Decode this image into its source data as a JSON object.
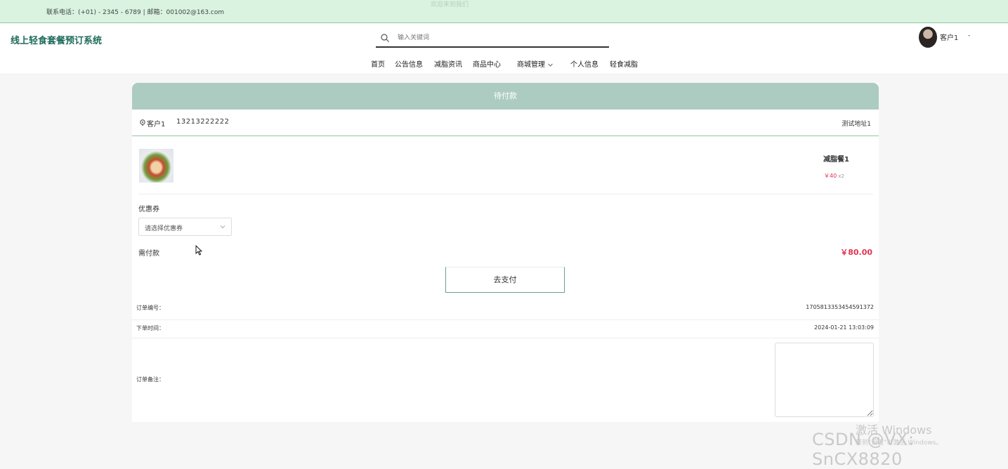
{
  "topbar": {
    "contact": "联系电话：(+01) - 2345 - 6789 | 邮箱：001002@163.com",
    "faint_text": "欢迎来到我们"
  },
  "header": {
    "title": "线上轻食套餐预订系统",
    "search_placeholder": "输入关键词",
    "username": "客户1",
    "user_dropdown": "-"
  },
  "nav": {
    "items": [
      "首页",
      "公告信息",
      "减脂资讯",
      "商品中心",
      "商城管理",
      "个人信息",
      "轻食减脂"
    ]
  },
  "order": {
    "status": "待付款",
    "address": {
      "name": "客户1",
      "phone": "13213222222",
      "detail": "测试地址1"
    },
    "item": {
      "name": "减脂餐1",
      "price": "￥40",
      "qty": "x2"
    },
    "coupon_label": "优惠券",
    "coupon_placeholder": "请选择优惠券",
    "pay_label": "需付款",
    "pay_amount": "￥80.00",
    "pay_button": "去支付",
    "info": [
      {
        "label": "订单编号：",
        "value": "1705813353454591372"
      },
      {
        "label": "下单时间：",
        "value": "2024-01-21 13:03:09"
      },
      {
        "label": "订单备注：",
        "value": ""
      }
    ]
  },
  "overlay": {
    "windows_title": "激活 Windows",
    "windows_sub": "转到\"设置\"以激活 Windows。",
    "csdn": "CSDN @VX: SnCX8820"
  },
  "colors": {
    "accent": "#adccc1",
    "price": "#e0344f",
    "topbar": "#d9f3e0",
    "brand": "#1f6b5a"
  }
}
